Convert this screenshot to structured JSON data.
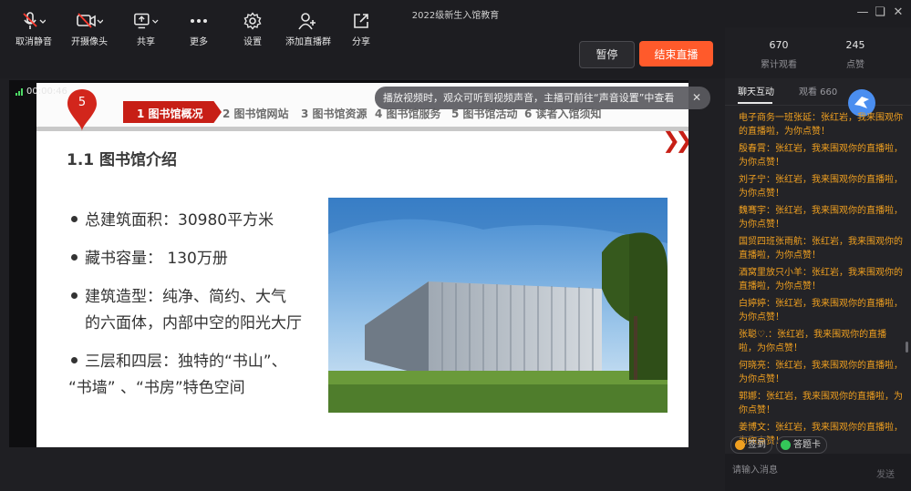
{
  "window": {
    "title": "2022级新生入馆教育"
  },
  "toolbar": {
    "items": [
      {
        "label": "取消静音",
        "icon": "mic-muted-icon"
      },
      {
        "label": "开摄像头",
        "icon": "camera-off-icon"
      },
      {
        "label": "共享",
        "icon": "share-screen-icon"
      },
      {
        "label": "更多",
        "icon": "more-icon"
      },
      {
        "label": "设置",
        "icon": "gear-icon"
      },
      {
        "label": "添加直播群",
        "icon": "add-group-icon"
      },
      {
        "label": "分享",
        "icon": "share-icon"
      }
    ],
    "pause_label": "暂停",
    "end_label": "结束直播"
  },
  "stats": [
    {
      "value": "670",
      "label": "累计观看"
    },
    {
      "value": "245",
      "label": "点赞"
    }
  ],
  "recording": {
    "time": "00:00:46"
  },
  "toast": {
    "text": "播放视频时，观众可听到视频声音，主播可前往“声音设置”中查看"
  },
  "slide": {
    "page_number": "5",
    "nav": [
      "1 图书馆概况",
      "2 图书馆网站",
      "3 图书馆资源",
      "4 图书馆服务",
      "5 图书馆活动",
      "6 读者入馆须知"
    ],
    "heading": "1.1 图书馆介绍",
    "bullets": [
      {
        "lines": [
          "总建筑面积：30980平方米"
        ]
      },
      {
        "lines": [
          "藏书容量： 130万册"
        ]
      },
      {
        "lines": [
          "建筑造型：纯净、简约、大气",
          "的六面体，内部中空的阳光大厅"
        ]
      },
      {
        "lines": [
          "三层和四层：独特的“书山”、",
          "“书墙” 、“书房”特色空间"
        ]
      }
    ]
  },
  "chat": {
    "tabs": [
      "聊天互动",
      "观看 660"
    ],
    "messages": [
      "电子商务一班张延：张红岩，我来围观你的直播啦，为你点赞！",
      "殷春霄：张红岩，我来围观你的直播啦，为你点赞！",
      "刘子宁：张红岩，我来围观你的直播啦，为你点赞！",
      "魏骞宇：张红岩，我来围观你的直播啦，为你点赞！",
      "国贸四班张雨航：张红岩，我来围观你的直播啦，为你点赞！",
      "酒窝里放只小羊：张红岩，我来围观你的直播啦，为你点赞！",
      "白婷婷：张红岩，我来围观你的直播啦，为你点赞！",
      "张聪♡.：张红岩，我来围观你的直播啦，为你点赞！",
      "何晓亮：张红岩，我来围观你的直播啦，为你点赞！",
      "郭娜：张红岩，我来围观你的直播啦，为你点赞！",
      "姜博文：张红岩，我来围观你的直播啦，为你点赞！"
    ],
    "chips": [
      "签到",
      "答题卡"
    ],
    "input_placeholder": "请输入消息",
    "send_label": "发送"
  }
}
